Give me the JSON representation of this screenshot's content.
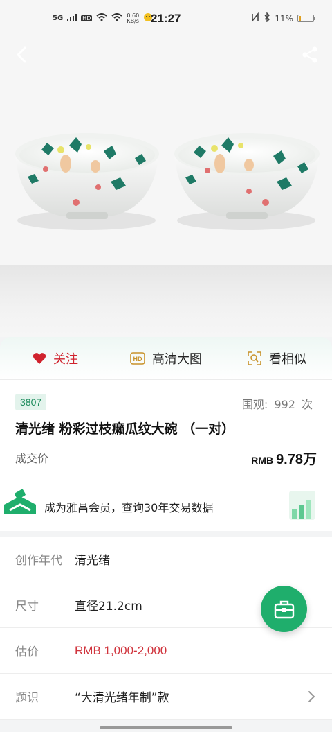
{
  "status_bar": {
    "network": "5G",
    "hd": "HD",
    "speed": "0.60",
    "speed_unit": "KB/s",
    "time": "21:27",
    "battery": "11%"
  },
  "item": {
    "lot_number": "3807",
    "views_label": "围观:",
    "views_count": "992",
    "views_unit": "次",
    "title": "清光绪 粉彩过枝癞瓜纹大碗 （一对）",
    "price_label": "成交价",
    "price_currency": "RMB",
    "price_value": "9.78万"
  },
  "actions": {
    "follow": "关注",
    "hd_image": "高清大图",
    "similar": "看相似"
  },
  "banner": {
    "text": "成为雅昌会员，查询30年交易数据"
  },
  "details": [
    {
      "label": "创作年代",
      "value": "清光绪"
    },
    {
      "label": "尺寸",
      "value": "直径21.2cm"
    },
    {
      "label": "估价",
      "value": "RMB  1,000-2,000"
    },
    {
      "label": "题识",
      "value": "“大清光绪年制”款"
    }
  ],
  "colors": {
    "accent_green": "#1fae6c",
    "accent_red": "#d0222d"
  }
}
